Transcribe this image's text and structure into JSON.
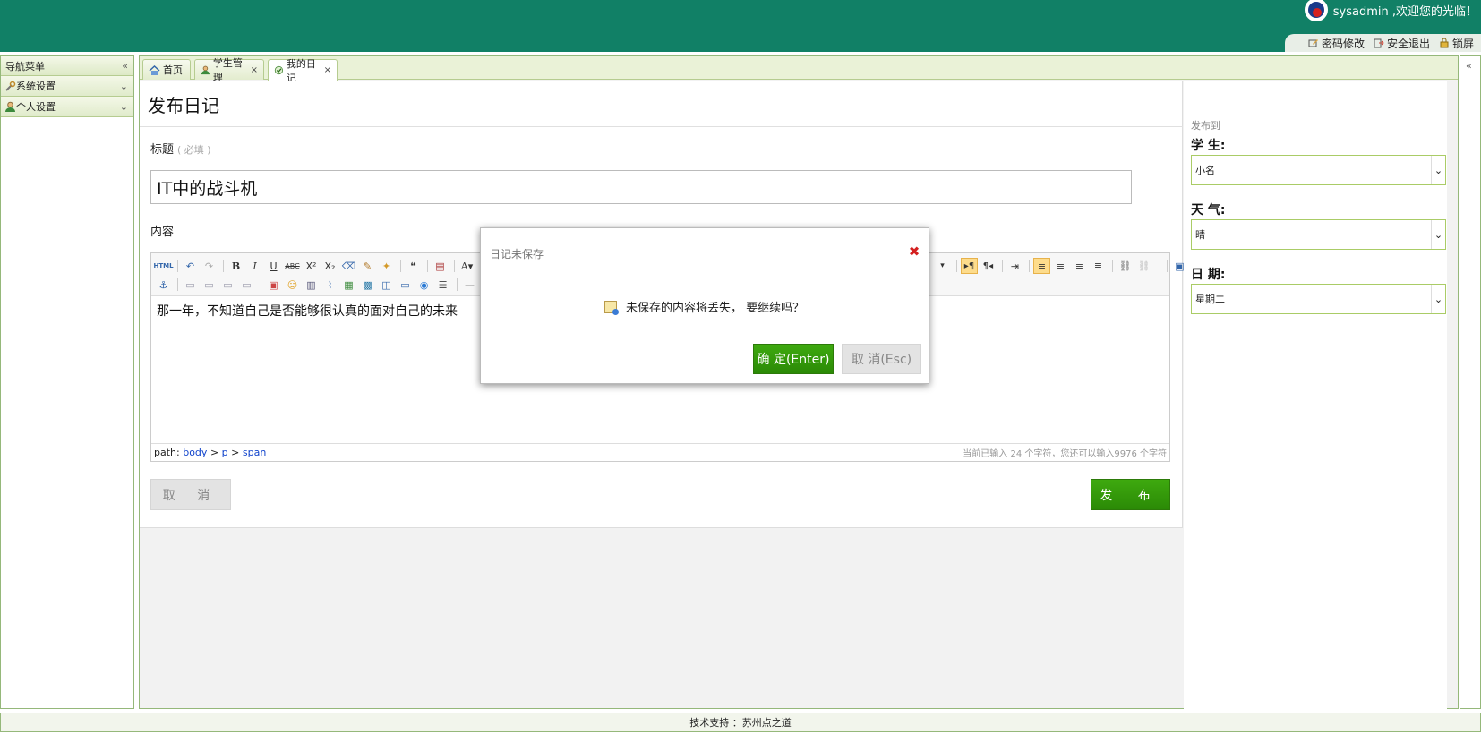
{
  "header": {
    "user_greeting": "sysadmin ,欢迎您的光临！",
    "links": {
      "password": "密码修改",
      "logout": "安全退出",
      "lock": "锁屏"
    }
  },
  "nav": {
    "title": "导航菜单",
    "items": [
      {
        "label": "系统设置",
        "icon": "wrench-icon"
      },
      {
        "label": "个人设置",
        "icon": "user-icon"
      }
    ]
  },
  "tabs": [
    {
      "label": "首页",
      "icon": "home-icon",
      "closable": false
    },
    {
      "label": "学生管理",
      "icon": "user-icon",
      "closable": true
    },
    {
      "label": "我的日记",
      "icon": "diary-icon",
      "closable": true,
      "active": true
    }
  ],
  "form": {
    "page_title": "发布日记",
    "title_label": "标题",
    "title_required": "( 必填 )",
    "title_value": "IT中的战斗机",
    "content_label": "内容",
    "content_text": "那一年，不知道自己是否能够很认真的面对自己的未来",
    "path_prefix": "path:",
    "path_items": [
      "body",
      "p",
      "span"
    ],
    "path_sep": ">",
    "counter": "当前已输入 24 个字符，您还可以输入9976 个字符",
    "cancel_label": "取 消",
    "publish_label": "发 布"
  },
  "sidepanel": {
    "head": "发布到",
    "student_label": "学 生:",
    "student_value": "小名",
    "weather_label": "天 气:",
    "weather_value": "晴",
    "date_label": "日 期:",
    "date_value": "星期二"
  },
  "dialog": {
    "title": "日记未保存",
    "message": "未保存的内容将丢失， 要继续吗？",
    "ok_label": "确 定(Enter)",
    "cancel_label": "取 消(Esc)"
  },
  "footer": {
    "text": "技术支持 ：苏州点之道"
  },
  "colors": {
    "header_bg": "#118066",
    "accent_green": "#2b8a06",
    "border_green": "#95b87a"
  }
}
